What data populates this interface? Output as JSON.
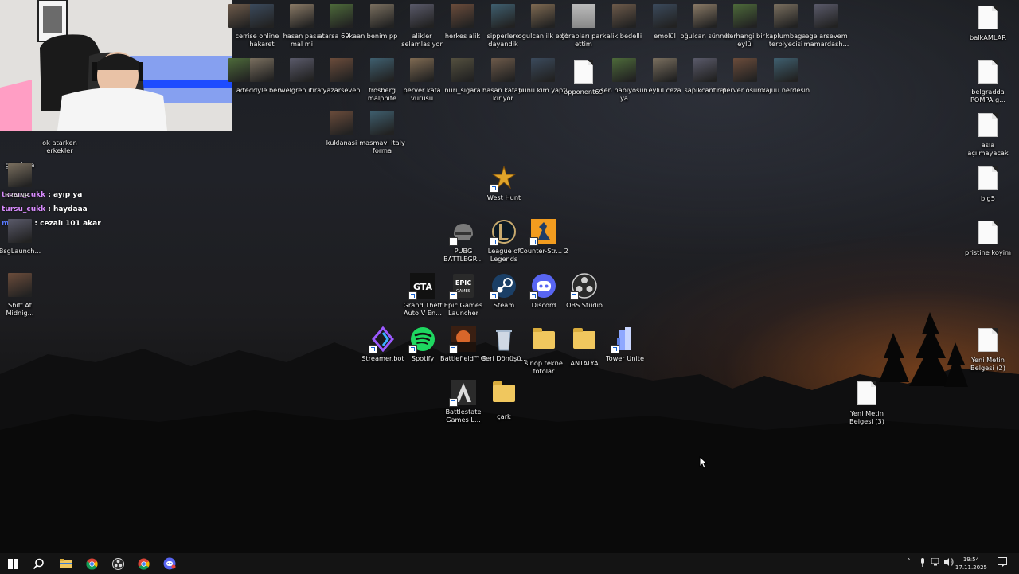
{
  "webcam": {
    "description_shown": "streamer webcam overlay"
  },
  "chat": [
    {
      "user": "tursu_cukk",
      "sep": " : ",
      "message": "ayıp ya",
      "color": "#c98bff"
    },
    {
      "user": "tursu_cukk",
      "sep": " : ",
      "message": "haydaaa",
      "color": "#c98bff"
    },
    {
      "user": "maxi6666",
      "sep": " : ",
      "message": "cezalı 101 akar",
      "color": "#5a7bff"
    }
  ],
  "chat_visible_names": [
    "tursu_cukk",
    "tursu_cukk",
    "ma...66"
  ],
  "desktop_icons": {
    "top_row": [
      {
        "label": "cer"
      },
      {
        "label": "rise online hakaret"
      },
      {
        "label": "hasan pasa mal mi"
      },
      {
        "label": "atarsa 69kaan"
      },
      {
        "label": "benim pp"
      },
      {
        "label": "alikler selamlasiyor"
      },
      {
        "label": "herkes alik"
      },
      {
        "label": "sipperlere dayandik"
      },
      {
        "label": "ogulcan ilk edit"
      },
      {
        "label": "çorapları park ettim"
      },
      {
        "label": "alik bedelli"
      },
      {
        "label": "emolül"
      },
      {
        "label": "oğulcan sünnet"
      },
      {
        "label": "herhangi bir eylül"
      },
      {
        "label": "kaplumbaga terbiyecisi"
      },
      {
        "label": "ege arsevem mamardash..."
      }
    ],
    "second_row": [
      {
        "label": "ad"
      },
      {
        "label": "teddyle ben"
      },
      {
        "label": "welgren itiraf"
      },
      {
        "label": "yazarseven"
      },
      {
        "label": "frosberg malphite"
      },
      {
        "label": "perver kafa vurusu"
      },
      {
        "label": "nuri_sigara"
      },
      {
        "label": "hasan kafayi kiriyor"
      },
      {
        "label": "bunu kim yapti"
      },
      {
        "label": "opponent69"
      },
      {
        "label": "sen nabiyosun ya"
      },
      {
        "label": "eylül ceza"
      },
      {
        "label": "sapikcanfirat"
      },
      {
        "label": "perver osurdu"
      },
      {
        "label": "kajuu nerdesin"
      }
    ],
    "third_row": [
      {
        "label": "kuklanasi"
      },
      {
        "label": "masmavi italy forma"
      }
    ],
    "left_column": [
      {
        "label": "gaazlaaa"
      },
      {
        "label": "ok atarken erkekler"
      },
      {
        "label": "BRAINR..."
      },
      {
        "label": "BsgLaunch..."
      },
      {
        "label": "Shift At Midnig..."
      }
    ],
    "apps": [
      {
        "label": "West Hunt"
      },
      {
        "label": "PUBG BATTLEGR..."
      },
      {
        "label": "League of Legends"
      },
      {
        "label": "Counter-Str... 2"
      },
      {
        "label": "Grand Theft Auto V En..."
      },
      {
        "label": "Epic Games Launcher"
      },
      {
        "label": "Steam"
      },
      {
        "label": "Discord"
      },
      {
        "label": "OBS Studio"
      },
      {
        "label": "Streamer.bot"
      },
      {
        "label": "Spotify"
      },
      {
        "label": "Battlefield™ 6"
      },
      {
        "label": "Geri Dönüşü..."
      },
      {
        "label": "sinop tekne fotolar"
      },
      {
        "label": "ANTALYA"
      },
      {
        "label": "Tower Unite"
      },
      {
        "label": "Battlestate Games L..."
      },
      {
        "label": "çark"
      }
    ],
    "right_column": [
      {
        "label": "balkAMLAR"
      },
      {
        "label": "belgradda POMPA g..."
      },
      {
        "label": "asla açılmayacak"
      },
      {
        "label": "big5"
      },
      {
        "label": "pristine koyim"
      },
      {
        "label": "Yeni Metin Belgesi (2)"
      },
      {
        "label": "Yeni Metin Belgesi (3)"
      }
    ]
  },
  "taskbar": {
    "start": "windows-start",
    "items": [
      "search",
      "file-explorer",
      "chrome",
      "obs",
      "chrome-profile",
      "discord-ptb"
    ],
    "time": "19:54",
    "date": "17.11.2025"
  },
  "colors": {
    "taskbar_bg": "#141414",
    "folder": "#f0c75e",
    "discord": "#5865f2",
    "spotify": "#1ed760",
    "cs2": "#f29c1f",
    "epic": "#2a2a2a"
  }
}
